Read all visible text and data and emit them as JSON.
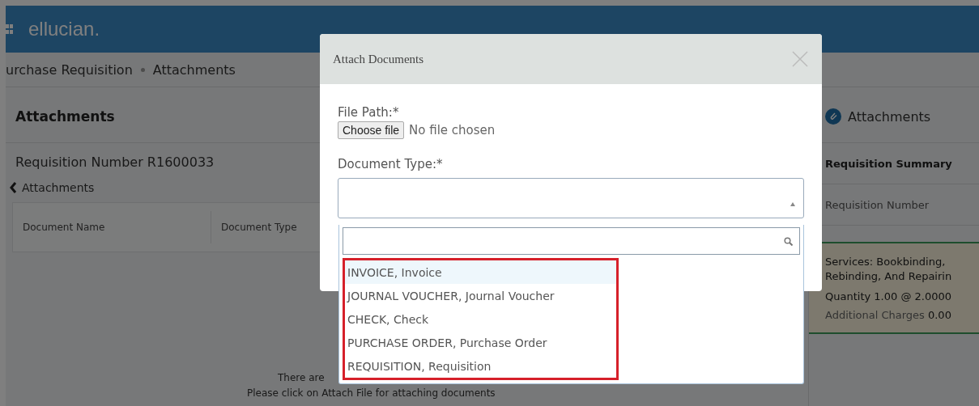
{
  "header": {
    "logo": "ellucian."
  },
  "breadcrumb": [
    "urchase Requisition",
    "Attachments"
  ],
  "page": {
    "title": "Attachments",
    "requisition": "Requisition Number R1600033",
    "back_link": "Attachments",
    "table": {
      "columns": [
        "Document Name",
        "Document Type"
      ]
    },
    "empty_message": [
      "There are",
      "Please click on Attach File for attaching documents"
    ]
  },
  "sidebar": {
    "title": "Attachments",
    "summary_title": "Requisition Summary",
    "number_label": "Requisition Number",
    "item": {
      "description": "Services: Bookbinding, Rebinding, And Repairin",
      "quantity": "Quantity 1.00 @ 2.0000",
      "charges_label": "Additional Charges",
      "charges_value": "0.00"
    }
  },
  "modal": {
    "title": "Attach Documents",
    "file_label": "File Path:",
    "file_button": "Choose file",
    "file_status": "No file chosen",
    "type_label": "Document Type:",
    "required_mark": "*",
    "dropdown": {
      "expanded": true,
      "options": [
        {
          "label": "INVOICE, Invoice",
          "selected": true
        },
        {
          "label": "JOURNAL VOUCHER, Journal Voucher",
          "selected": false
        },
        {
          "label": "CHECK, Check",
          "selected": false
        },
        {
          "label": "PURCHASE ORDER, Purchase Order",
          "selected": false
        },
        {
          "label": "REQUISITION, Requisition",
          "selected": false
        }
      ]
    }
  }
}
